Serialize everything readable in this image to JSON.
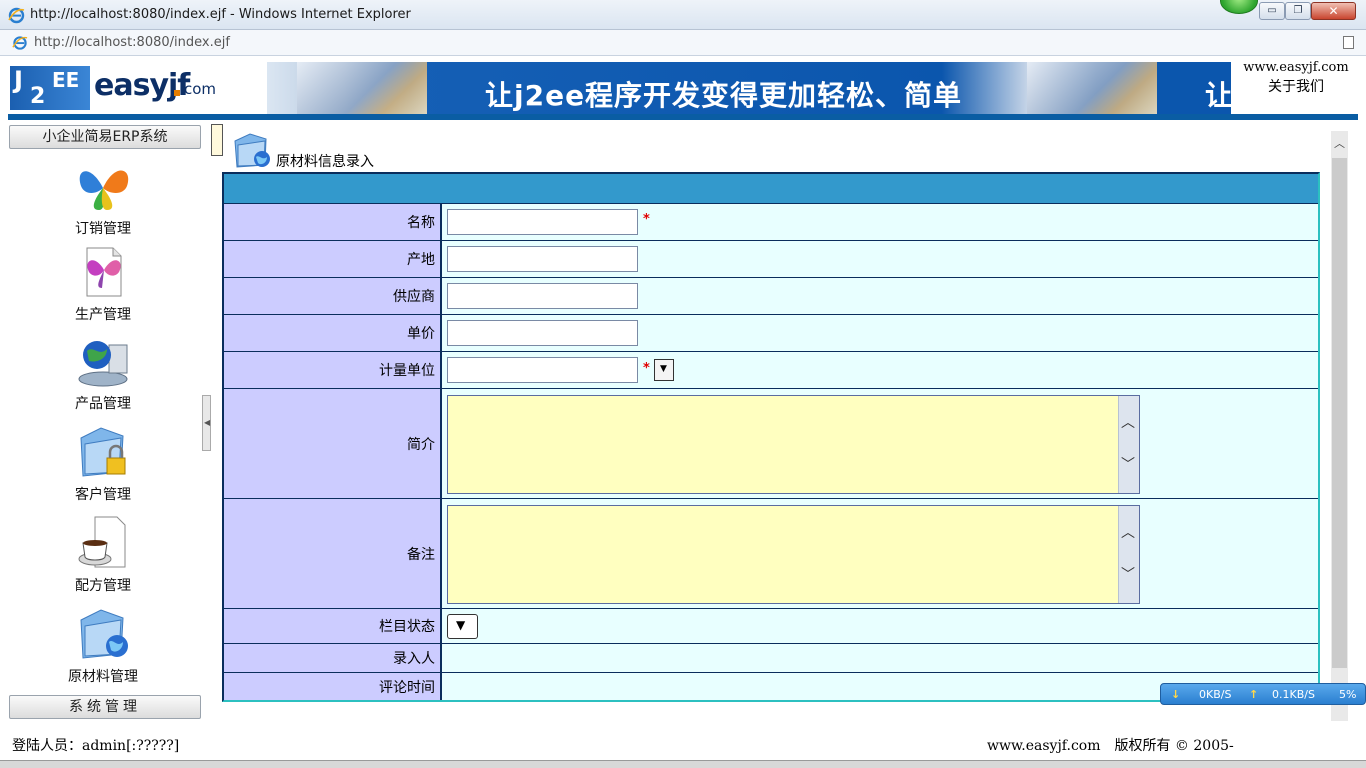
{
  "window": {
    "title": "http://localhost:8080/index.ejf - Windows Internet Explorer",
    "url": "http://localhost:8080/index.ejf",
    "min_glyph": "▭",
    "max_glyph": "❐",
    "close_glyph": "✕"
  },
  "banner": {
    "logo_j": "J",
    "logo_2": "2",
    "logo_ee": "EE",
    "logo_brand": "easyjf",
    "logo_dotcom": "com",
    "slogan": "让j2ee程序开发变得更加轻松、简单",
    "slogan_tail": "让",
    "site": "www.easyjf.com",
    "about": "关于我们"
  },
  "sidebar": {
    "header": "小企业简易ERP系统",
    "items": [
      {
        "label": "订销管理",
        "icon": "butterfly-icon"
      },
      {
        "label": "生产管理",
        "icon": "document-butterfly-icon"
      },
      {
        "label": "产品管理",
        "icon": "globe-computer-icon"
      },
      {
        "label": "客户管理",
        "icon": "folder-lock-icon"
      },
      {
        "label": "配方管理",
        "icon": "coffee-document-icon"
      },
      {
        "label": "原材料管理",
        "icon": "folder-globe-icon"
      }
    ],
    "footer": "系统管理"
  },
  "main": {
    "title": "原材料信息录入",
    "fields": {
      "name": {
        "label": "名称",
        "value": "",
        "required": "*"
      },
      "origin": {
        "label": "产地",
        "value": ""
      },
      "supplier": {
        "label": "供应商",
        "value": ""
      },
      "price": {
        "label": "单价",
        "value": ""
      },
      "unit": {
        "label": "计量单位",
        "value": "",
        "required": "*"
      },
      "intro": {
        "label": "简介",
        "value": ""
      },
      "note": {
        "label": "备注",
        "value": ""
      },
      "status": {
        "label": "栏目状态",
        "value": ""
      },
      "entered_by": {
        "label": "录入人",
        "value": ""
      },
      "comment_time": {
        "label": "评论时间",
        "value": ""
      }
    }
  },
  "netwidget": {
    "down": "0KB/S",
    "up": "0.1KB/S",
    "percent": "5%"
  },
  "footer": {
    "login": "登陆人员：admin[:?????]",
    "copyright": "www.easyjf.com　版权所有 © 2005-"
  },
  "colors": {
    "label_bg": "#ccccff",
    "value_bg": "#e8ffff",
    "header_bg": "#3399cc",
    "textarea_bg": "#ffffc0",
    "banner_blue": "#0a5da3"
  }
}
